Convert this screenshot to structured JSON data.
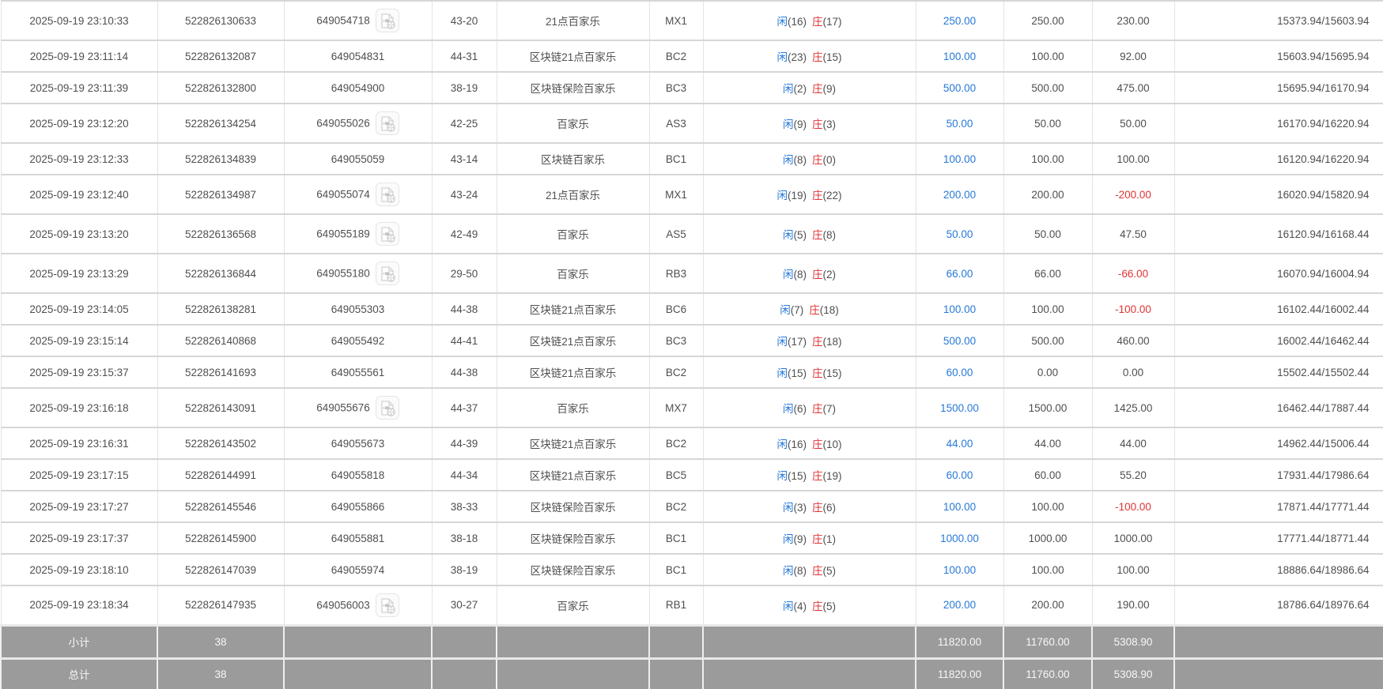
{
  "table_name": "betting-records",
  "labels": {
    "player": "闲",
    "banker": "庄",
    "subtotal": "小计",
    "total": "总计"
  },
  "colors": {
    "link_blue": "#2779d8",
    "player_blue": "#2779d8",
    "banker_red": "#e03333",
    "negative_red": "#e03333",
    "row_text": "#4f4f4f",
    "summary_bg": "#9b9b9b"
  },
  "icons": {
    "video": "video-playback-icon"
  },
  "rows": [
    {
      "time": "2025-09-19 23:10:33",
      "serial": "522826130633",
      "game_no": "649054718",
      "has_video": true,
      "score": "43-20",
      "game": "21点百家乐",
      "table_code": "MX1",
      "player": "16",
      "banker": "17",
      "bet": "250.00",
      "valid": "250.00",
      "winloss": "230.00",
      "balance": "15373.94/15603.94"
    },
    {
      "time": "2025-09-19 23:11:14",
      "serial": "522826132087",
      "game_no": "649054831",
      "has_video": false,
      "score": "44-31",
      "game": "区块链21点百家乐",
      "table_code": "BC2",
      "player": "23",
      "banker": "15",
      "bet": "100.00",
      "valid": "100.00",
      "winloss": "92.00",
      "balance": "15603.94/15695.94"
    },
    {
      "time": "2025-09-19 23:11:39",
      "serial": "522826132800",
      "game_no": "649054900",
      "has_video": false,
      "score": "38-19",
      "game": "区块链保险百家乐",
      "table_code": "BC3",
      "player": "2",
      "banker": "9",
      "bet": "500.00",
      "valid": "500.00",
      "winloss": "475.00",
      "balance": "15695.94/16170.94"
    },
    {
      "time": "2025-09-19 23:12:20",
      "serial": "522826134254",
      "game_no": "649055026",
      "has_video": true,
      "score": "42-25",
      "game": "百家乐",
      "table_code": "AS3",
      "player": "9",
      "banker": "3",
      "bet": "50.00",
      "valid": "50.00",
      "winloss": "50.00",
      "balance": "16170.94/16220.94"
    },
    {
      "time": "2025-09-19 23:12:33",
      "serial": "522826134839",
      "game_no": "649055059",
      "has_video": false,
      "score": "43-14",
      "game": "区块链百家乐",
      "table_code": "BC1",
      "player": "8",
      "banker": "0",
      "bet": "100.00",
      "valid": "100.00",
      "winloss": "100.00",
      "balance": "16120.94/16220.94"
    },
    {
      "time": "2025-09-19 23:12:40",
      "serial": "522826134987",
      "game_no": "649055074",
      "has_video": true,
      "score": "43-24",
      "game": "21点百家乐",
      "table_code": "MX1",
      "player": "19",
      "banker": "22",
      "bet": "200.00",
      "valid": "200.00",
      "winloss": "-200.00",
      "balance": "16020.94/15820.94"
    },
    {
      "time": "2025-09-19 23:13:20",
      "serial": "522826136568",
      "game_no": "649055189",
      "has_video": true,
      "score": "42-49",
      "game": "百家乐",
      "table_code": "AS5",
      "player": "5",
      "banker": "8",
      "bet": "50.00",
      "valid": "50.00",
      "winloss": "47.50",
      "balance": "16120.94/16168.44"
    },
    {
      "time": "2025-09-19 23:13:29",
      "serial": "522826136844",
      "game_no": "649055180",
      "has_video": true,
      "score": "29-50",
      "game": "百家乐",
      "table_code": "RB3",
      "player": "8",
      "banker": "2",
      "bet": "66.00",
      "valid": "66.00",
      "winloss": "-66.00",
      "balance": "16070.94/16004.94"
    },
    {
      "time": "2025-09-19 23:14:05",
      "serial": "522826138281",
      "game_no": "649055303",
      "has_video": false,
      "score": "44-38",
      "game": "区块链21点百家乐",
      "table_code": "BC6",
      "player": "7",
      "banker": "18",
      "bet": "100.00",
      "valid": "100.00",
      "winloss": "-100.00",
      "balance": "16102.44/16002.44"
    },
    {
      "time": "2025-09-19 23:15:14",
      "serial": "522826140868",
      "game_no": "649055492",
      "has_video": false,
      "score": "44-41",
      "game": "区块链21点百家乐",
      "table_code": "BC3",
      "player": "17",
      "banker": "18",
      "bet": "500.00",
      "valid": "500.00",
      "winloss": "460.00",
      "balance": "16002.44/16462.44"
    },
    {
      "time": "2025-09-19 23:15:37",
      "serial": "522826141693",
      "game_no": "649055561",
      "has_video": false,
      "score": "44-38",
      "game": "区块链21点百家乐",
      "table_code": "BC2",
      "player": "15",
      "banker": "15",
      "bet": "60.00",
      "valid": "0.00",
      "winloss": "0.00",
      "balance": "15502.44/15502.44"
    },
    {
      "time": "2025-09-19 23:16:18",
      "serial": "522826143091",
      "game_no": "649055676",
      "has_video": true,
      "score": "44-37",
      "game": "百家乐",
      "table_code": "MX7",
      "player": "6",
      "banker": "7",
      "bet": "1500.00",
      "valid": "1500.00",
      "winloss": "1425.00",
      "balance": "16462.44/17887.44"
    },
    {
      "time": "2025-09-19 23:16:31",
      "serial": "522826143502",
      "game_no": "649055673",
      "has_video": false,
      "score": "44-39",
      "game": "区块链21点百家乐",
      "table_code": "BC2",
      "player": "16",
      "banker": "10",
      "bet": "44.00",
      "valid": "44.00",
      "winloss": "44.00",
      "balance": "14962.44/15006.44"
    },
    {
      "time": "2025-09-19 23:17:15",
      "serial": "522826144991",
      "game_no": "649055818",
      "has_video": false,
      "score": "44-34",
      "game": "区块链21点百家乐",
      "table_code": "BC5",
      "player": "15",
      "banker": "19",
      "bet": "60.00",
      "valid": "60.00",
      "winloss": "55.20",
      "balance": "17931.44/17986.64"
    },
    {
      "time": "2025-09-19 23:17:27",
      "serial": "522826145546",
      "game_no": "649055866",
      "has_video": false,
      "score": "38-33",
      "game": "区块链保险百家乐",
      "table_code": "BC2",
      "player": "3",
      "banker": "6",
      "bet": "100.00",
      "valid": "100.00",
      "winloss": "-100.00",
      "balance": "17871.44/17771.44"
    },
    {
      "time": "2025-09-19 23:17:37",
      "serial": "522826145900",
      "game_no": "649055881",
      "has_video": false,
      "score": "38-18",
      "game": "区块链保险百家乐",
      "table_code": "BC1",
      "player": "9",
      "banker": "1",
      "bet": "1000.00",
      "valid": "1000.00",
      "winloss": "1000.00",
      "balance": "17771.44/18771.44"
    },
    {
      "time": "2025-09-19 23:18:10",
      "serial": "522826147039",
      "game_no": "649055974",
      "has_video": false,
      "score": "38-19",
      "game": "区块链保险百家乐",
      "table_code": "BC1",
      "player": "8",
      "banker": "5",
      "bet": "100.00",
      "valid": "100.00",
      "winloss": "100.00",
      "balance": "18886.64/18986.64"
    },
    {
      "time": "2025-09-19 23:18:34",
      "serial": "522826147935",
      "game_no": "649056003",
      "has_video": true,
      "score": "30-27",
      "game": "百家乐",
      "table_code": "RB1",
      "player": "4",
      "banker": "5",
      "bet": "200.00",
      "valid": "200.00",
      "winloss": "190.00",
      "balance": "18786.64/18976.64"
    }
  ],
  "summary": {
    "subtotal": {
      "label": "小计",
      "count": "38",
      "bet": "11820.00",
      "valid": "11760.00",
      "winloss": "5308.90"
    },
    "total": {
      "label": "总计",
      "count": "38",
      "bet": "11820.00",
      "valid": "11760.00",
      "winloss": "5308.90"
    }
  }
}
